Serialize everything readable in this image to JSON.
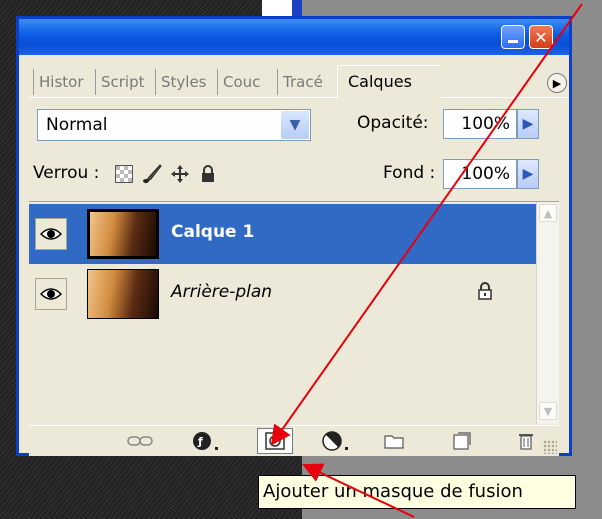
{
  "tabs": [
    {
      "label": "Histor"
    },
    {
      "label": "Script"
    },
    {
      "label": "Styles"
    },
    {
      "label": "Couc"
    },
    {
      "label": "Tracé"
    },
    {
      "label": "Calques",
      "active": true
    }
  ],
  "blend_mode": {
    "value": "Normal"
  },
  "opacity": {
    "label": "Opacité:",
    "value": "100%"
  },
  "lock": {
    "label": "Verrou :"
  },
  "fill": {
    "label": "Fond :",
    "value": "100%"
  },
  "layers": [
    {
      "name": "Calque 1",
      "selected": true,
      "visible": true,
      "locked": false
    },
    {
      "name": "Arrière-plan",
      "selected": false,
      "visible": true,
      "locked": true
    }
  ],
  "tooltip": {
    "text": "Ajouter un masque de fusion"
  },
  "colors": {
    "selection": "#316ac5",
    "annotation_arrow": "#e8000c",
    "titlebar": "#0b5be4"
  },
  "icons": {
    "eye": "eye-icon",
    "lock": "lock-icon",
    "link": "link-icon",
    "fx": "fx-icon",
    "mask": "mask-icon",
    "adjustment": "adjustment-icon",
    "group": "folder-icon",
    "new_layer": "new-layer-icon",
    "delete": "trash-icon"
  }
}
